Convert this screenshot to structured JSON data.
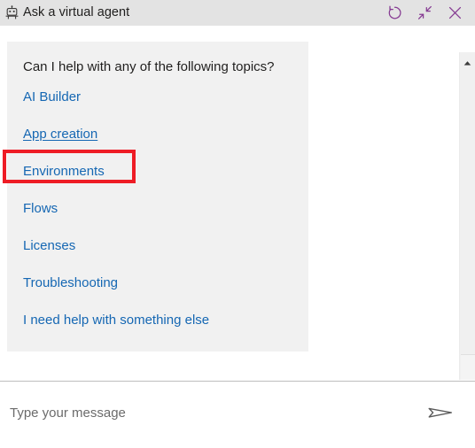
{
  "window": {
    "title": "Ask a virtual agent",
    "bot_icon": "robot-icon",
    "actions": [
      {
        "name": "restart-conversation",
        "icon": "refresh-circular-arrow-icon",
        "label": "Restart"
      },
      {
        "name": "minimize-window",
        "icon": "collapse-diagonal-arrows-icon",
        "label": "Minimize"
      },
      {
        "name": "close-window",
        "icon": "close-x-icon",
        "label": "Close"
      }
    ],
    "titlebar_background": "#e3e3e3",
    "action_icon_color": "#853a92"
  },
  "chat": {
    "bubble": {
      "prompt": "Can I help with any of the following topics?",
      "background": "#f1f1f1",
      "link_color": "#1567b3",
      "topics": [
        {
          "label": "AI Builder",
          "hovered": false
        },
        {
          "label": "App creation",
          "hovered": true
        },
        {
          "label": "Environments",
          "hovered": false
        },
        {
          "label": "Flows",
          "hovered": false
        },
        {
          "label": "Licenses",
          "hovered": false
        },
        {
          "label": "Troubleshooting",
          "hovered": false
        },
        {
          "label": "I need help with something else",
          "hovered": false
        }
      ]
    },
    "annotation": {
      "name": "highlight-box",
      "target": "App creation",
      "color": "#ee1c25"
    },
    "scrollbar": {
      "up_arrow_icon": "scroll-up-arrow-icon",
      "down_arrow_icon": "scroll-down-arrow-icon",
      "orientation": "vertical"
    }
  },
  "composer": {
    "placeholder": "Type your message",
    "value": "",
    "send_icon": "send-paper-plane-icon",
    "send_label": "Send"
  }
}
